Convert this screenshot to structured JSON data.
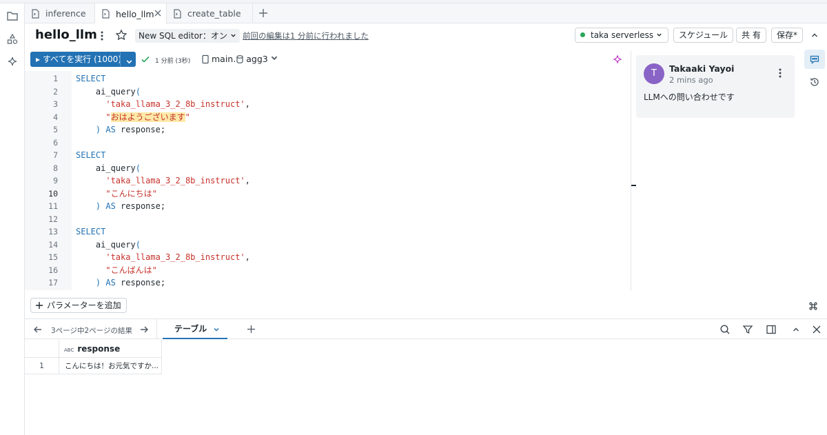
{
  "tabs": [
    {
      "label": "inference"
    },
    {
      "label": "hello_llm"
    },
    {
      "label": "create_table"
    }
  ],
  "header": {
    "title": "hello_llm",
    "editor_mode": "New SQL editor：オン",
    "last_edited": "前回の編集は1 分前に行われました",
    "compute": "taka serverless",
    "schedule": "スケジュール",
    "share": "共 有",
    "save": "保存*"
  },
  "toolbar": {
    "run_all": "▸ すべてを実行 (1000)",
    "run_time": "1 分前",
    "run_duration": "(3秒)",
    "catalog": "main",
    "schema": "agg3"
  },
  "editor": {
    "current_line": 10,
    "lines": [
      {
        "n": "1",
        "t": "SELECT"
      },
      {
        "n": "2",
        "t": "    ai_query("
      },
      {
        "n": "3",
        "t": "      'taka_llama_3_2_8b_instruct',"
      },
      {
        "n": "4",
        "t": "      \"おはようございます\""
      },
      {
        "n": "5",
        "t": "    ) AS response;"
      },
      {
        "n": "6",
        "t": ""
      },
      {
        "n": "7",
        "t": "SELECT"
      },
      {
        "n": "8",
        "t": "    ai_query("
      },
      {
        "n": "9",
        "t": "      'taka_llama_3_2_8b_instruct',"
      },
      {
        "n": "10",
        "t": "      \"こんにちは\""
      },
      {
        "n": "11",
        "t": "    ) AS response;"
      },
      {
        "n": "12",
        "t": ""
      },
      {
        "n": "13",
        "t": "SELECT"
      },
      {
        "n": "14",
        "t": "    ai_query("
      },
      {
        "n": "15",
        "t": "      'taka_llama_3_2_8b_instruct',"
      },
      {
        "n": "16",
        "t": "      \"こんばんは\""
      },
      {
        "n": "17",
        "t": "    ) AS response;"
      }
    ]
  },
  "comment": {
    "avatar": "T",
    "author": "Takaaki Yayoi",
    "time": "2 mins ago",
    "text": "LLMへの問い合わせです"
  },
  "params": {
    "add_label": "パラメーターを追加"
  },
  "results": {
    "page_info": "3ページ中2ページの結果",
    "tab": "テーブル",
    "column": "response",
    "column_type": "ABC",
    "rows": [
      {
        "n": "1",
        "response": "こんにちは！お元気ですか..."
      }
    ]
  },
  "colors": {
    "accent": "#2272b4",
    "keyword": "#2272b4",
    "string": "#c7322b",
    "highlight": "#fde9a8",
    "status": "#2aa65a",
    "avatar": "#8a63c6"
  }
}
